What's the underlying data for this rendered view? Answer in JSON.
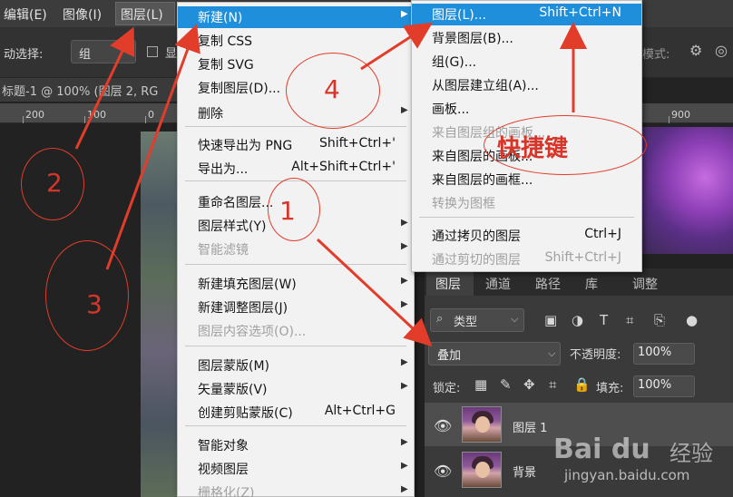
{
  "menubar": {
    "items": [
      "编辑(E)",
      "图像(I)",
      "图层(L)"
    ]
  },
  "options_bar": {
    "auto_select_label": "动选择:",
    "auto_select_value": "组",
    "show_label": "显",
    "mode_label": "模式:"
  },
  "document_tab": {
    "title": "标题-1 @ 100% (图层 2, RG"
  },
  "ruler": {
    "labels": [
      "200",
      "100",
      "0",
      "900"
    ]
  },
  "layer_menu": {
    "items": [
      {
        "label": "新建(N)",
        "shortcut": "",
        "submenu": true,
        "highlighted": true,
        "disabled": false
      },
      {
        "label": "复制 CSS",
        "shortcut": "",
        "submenu": false,
        "disabled": false
      },
      {
        "label": "复制 SVG",
        "shortcut": "",
        "submenu": false,
        "disabled": false
      },
      {
        "label": "复制图层(D)...",
        "shortcut": "",
        "submenu": false,
        "disabled": false
      },
      {
        "label": "删除",
        "shortcut": "",
        "submenu": true,
        "disabled": false
      },
      {
        "label": "快速导出为 PNG",
        "shortcut": "Shift+Ctrl+'",
        "submenu": false,
        "disabled": false
      },
      {
        "label": "导出为...",
        "shortcut": "Alt+Shift+Ctrl+'",
        "submenu": false,
        "disabled": false
      },
      {
        "label": "重命名图层...",
        "shortcut": "",
        "submenu": false,
        "disabled": false
      },
      {
        "label": "图层样式(Y)",
        "shortcut": "",
        "submenu": true,
        "disabled": false
      },
      {
        "label": "智能滤镜",
        "shortcut": "",
        "submenu": true,
        "disabled": true
      },
      {
        "label": "新建填充图层(W)",
        "shortcut": "",
        "submenu": true,
        "disabled": false
      },
      {
        "label": "新建调整图层(J)",
        "shortcut": "",
        "submenu": true,
        "disabled": false
      },
      {
        "label": "图层内容选项(O)...",
        "shortcut": "",
        "submenu": false,
        "disabled": true
      },
      {
        "label": "图层蒙版(M)",
        "shortcut": "",
        "submenu": true,
        "disabled": false
      },
      {
        "label": "矢量蒙版(V)",
        "shortcut": "",
        "submenu": true,
        "disabled": false
      },
      {
        "label": "创建剪贴蒙版(C)",
        "shortcut": "Alt+Ctrl+G",
        "submenu": false,
        "disabled": false
      },
      {
        "label": "智能对象",
        "shortcut": "",
        "submenu": true,
        "disabled": false
      },
      {
        "label": "视频图层",
        "shortcut": "",
        "submenu": true,
        "disabled": false
      },
      {
        "label": "栅格化(Z)",
        "shortcut": "",
        "submenu": true,
        "disabled": true
      }
    ]
  },
  "new_submenu": {
    "items": [
      {
        "label": "图层(L)...",
        "shortcut": "Shift+Ctrl+N",
        "highlighted": true,
        "disabled": false
      },
      {
        "label": "背景图层(B)...",
        "shortcut": "",
        "disabled": false
      },
      {
        "label": "组(G)...",
        "shortcut": "",
        "disabled": false
      },
      {
        "label": "从图层建立组(A)...",
        "shortcut": "",
        "disabled": false
      },
      {
        "label": "画板...",
        "shortcut": "",
        "disabled": false
      },
      {
        "label": "来自图层组的画板...",
        "shortcut": "",
        "disabled": true
      },
      {
        "label": "来自图层的画板...",
        "shortcut": "",
        "disabled": false
      },
      {
        "label": "来自图层的画框...",
        "shortcut": "",
        "disabled": false
      },
      {
        "label": "转换为图框",
        "shortcut": "",
        "disabled": true
      },
      {
        "label": "通过拷贝的图层",
        "shortcut": "Ctrl+J",
        "disabled": false
      },
      {
        "label": "通过剪切的图层",
        "shortcut": "Shift+Ctrl+J",
        "disabled": true
      }
    ]
  },
  "layers_panel": {
    "tabs": [
      "图层",
      "通道",
      "路径",
      "库",
      "调整"
    ],
    "filter_label": "类型",
    "blend_mode": "叠加",
    "opacity_label": "不透明度:",
    "opacity_value": "100%",
    "lock_label": "锁定:",
    "fill_label": "填充:",
    "fill_value": "100%",
    "layers": [
      {
        "name": "图层 1"
      },
      {
        "name": "背景"
      }
    ]
  },
  "annotations": {
    "numbers": [
      "1",
      "2",
      "3",
      "4"
    ],
    "shortcut_note": "快捷键"
  },
  "watermark": {
    "logo": "Bai du",
    "text": "经验",
    "url": "jingyan.baidu.com"
  },
  "colors": {
    "highlight": "#1f8fdc",
    "annotation_red": "#d8352a"
  }
}
